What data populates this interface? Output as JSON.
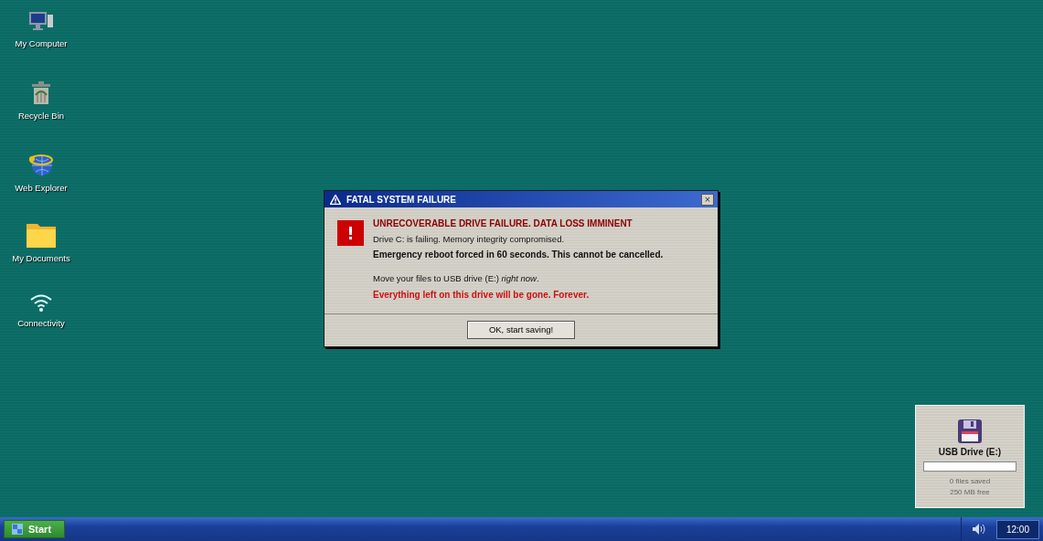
{
  "desktop_icons": [
    {
      "kind": "computer",
      "label": "My Computer"
    },
    {
      "kind": "trash",
      "label": "Recycle Bin"
    },
    {
      "kind": "globe",
      "label": "Web Explorer"
    },
    {
      "kind": "folder",
      "label": "My Documents"
    },
    {
      "kind": "wifi",
      "label": "Connectivity"
    }
  ],
  "dialog": {
    "title": "FATAL SYSTEM FAILURE",
    "close": "×",
    "heading": "UNRECOVERABLE DRIVE FAILURE. DATA LOSS IMMINENT",
    "paragraphs": [
      [
        {
          "kind": "plain",
          "text": "Drive C: is failing. Memory integrity compromised."
        },
        {
          "kind": "bold",
          "text": "Emergency reboot forced in 60 seconds. This cannot be cancelled."
        }
      ],
      [
        {
          "kind": "plain",
          "text": "Move your files to USB drive (E:) *right now*."
        },
        {
          "kind": "alert",
          "text": "Everything left on this drive will be gone. Forever."
        }
      ]
    ],
    "button": "OK, start saving!"
  },
  "usb_panel": {
    "title": "USB Drive (E:)",
    "level": 0,
    "saved": "0 files saved",
    "free": "250 MB free"
  },
  "taskbar": {
    "start": "Start",
    "clock": "12:00"
  }
}
